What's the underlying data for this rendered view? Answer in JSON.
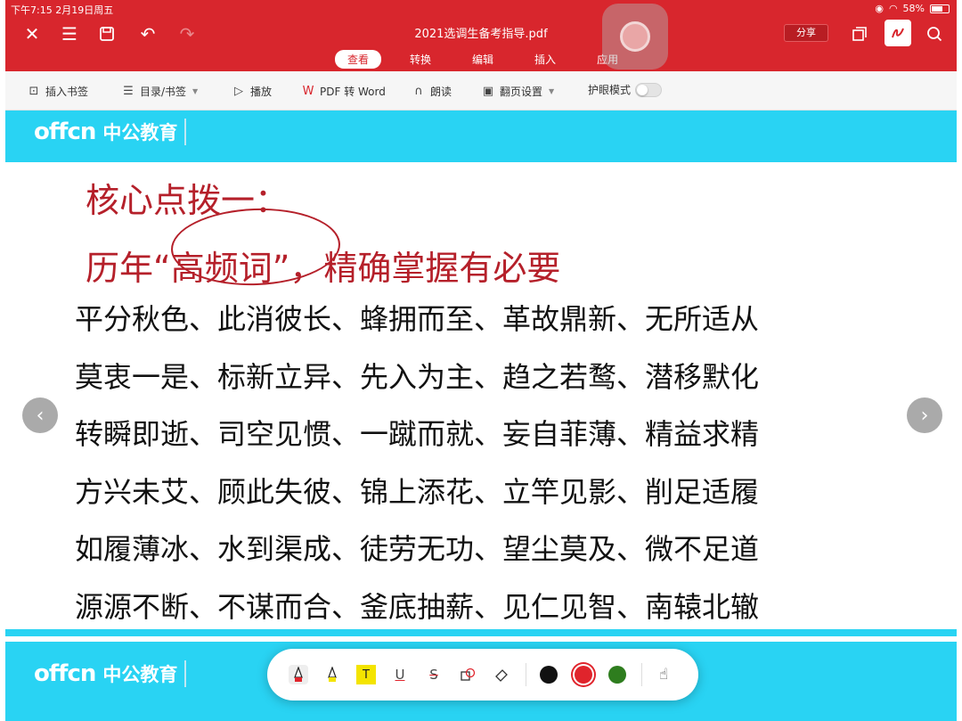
{
  "status_bar": {
    "time_date": "下午7:15   2月19日周五",
    "battery": "58%"
  },
  "header": {
    "doc_title": "2021选调生备考指导.pdf",
    "share_label": "分享",
    "tabs": [
      {
        "label": "查看",
        "active": true
      },
      {
        "label": "转换",
        "active": false
      },
      {
        "label": "编辑",
        "active": false
      },
      {
        "label": "插入",
        "active": false
      },
      {
        "label": "应用",
        "active": false
      }
    ],
    "accent_color": "#d8262d"
  },
  "toolbar": {
    "bookmark_insert": "插入书签",
    "toc_bookmark": "目录/书签",
    "play": "播放",
    "pdf_to_word": "PDF 转 Word",
    "read_aloud": "朗读",
    "page_turn_settings": "翻页设置",
    "eye_care_mode": "护眼模式",
    "eye_care_on": false
  },
  "document": {
    "brand_logo": "offcn",
    "brand_name": "中公教育",
    "heading1": "核心点拨一：",
    "heading2_a": "历年",
    "heading2_quote": "“高频词”",
    "heading2_b": "，精确掌握有必要",
    "lines": [
      "平分秋色、此消彼长、蜂拥而至、革故鼎新、无所适从",
      "莫衷一是、标新立异、先入为主、趋之若鹜、潜移默化",
      "转瞬即逝、司空见惯、一蹴而就、妄自菲薄、精益求精",
      "方兴未艾、顾此失彼、锦上添花、立竿见影、削足适履",
      "如履薄冰、水到渠成、徒劳无功、望尘莫及、微不足道",
      "源源不断、不谋而合、釜底抽薪、见仁见智、南辕北辙"
    ],
    "band_color": "#29d3f3",
    "heading_color": "#b5202a"
  },
  "annotation_dock": {
    "tools": [
      "pen-tool",
      "highlighter-tool",
      "text-highlight-tool",
      "underline-tool",
      "strikethrough-tool",
      "shape-tool",
      "eraser-tool"
    ],
    "text_tool_glyph": "T",
    "underline_glyph": "U",
    "strike_glyph": "S",
    "colors": [
      "#111111",
      "#e0242c",
      "#2e7d1e"
    ],
    "selected_color": "#e0242c"
  }
}
